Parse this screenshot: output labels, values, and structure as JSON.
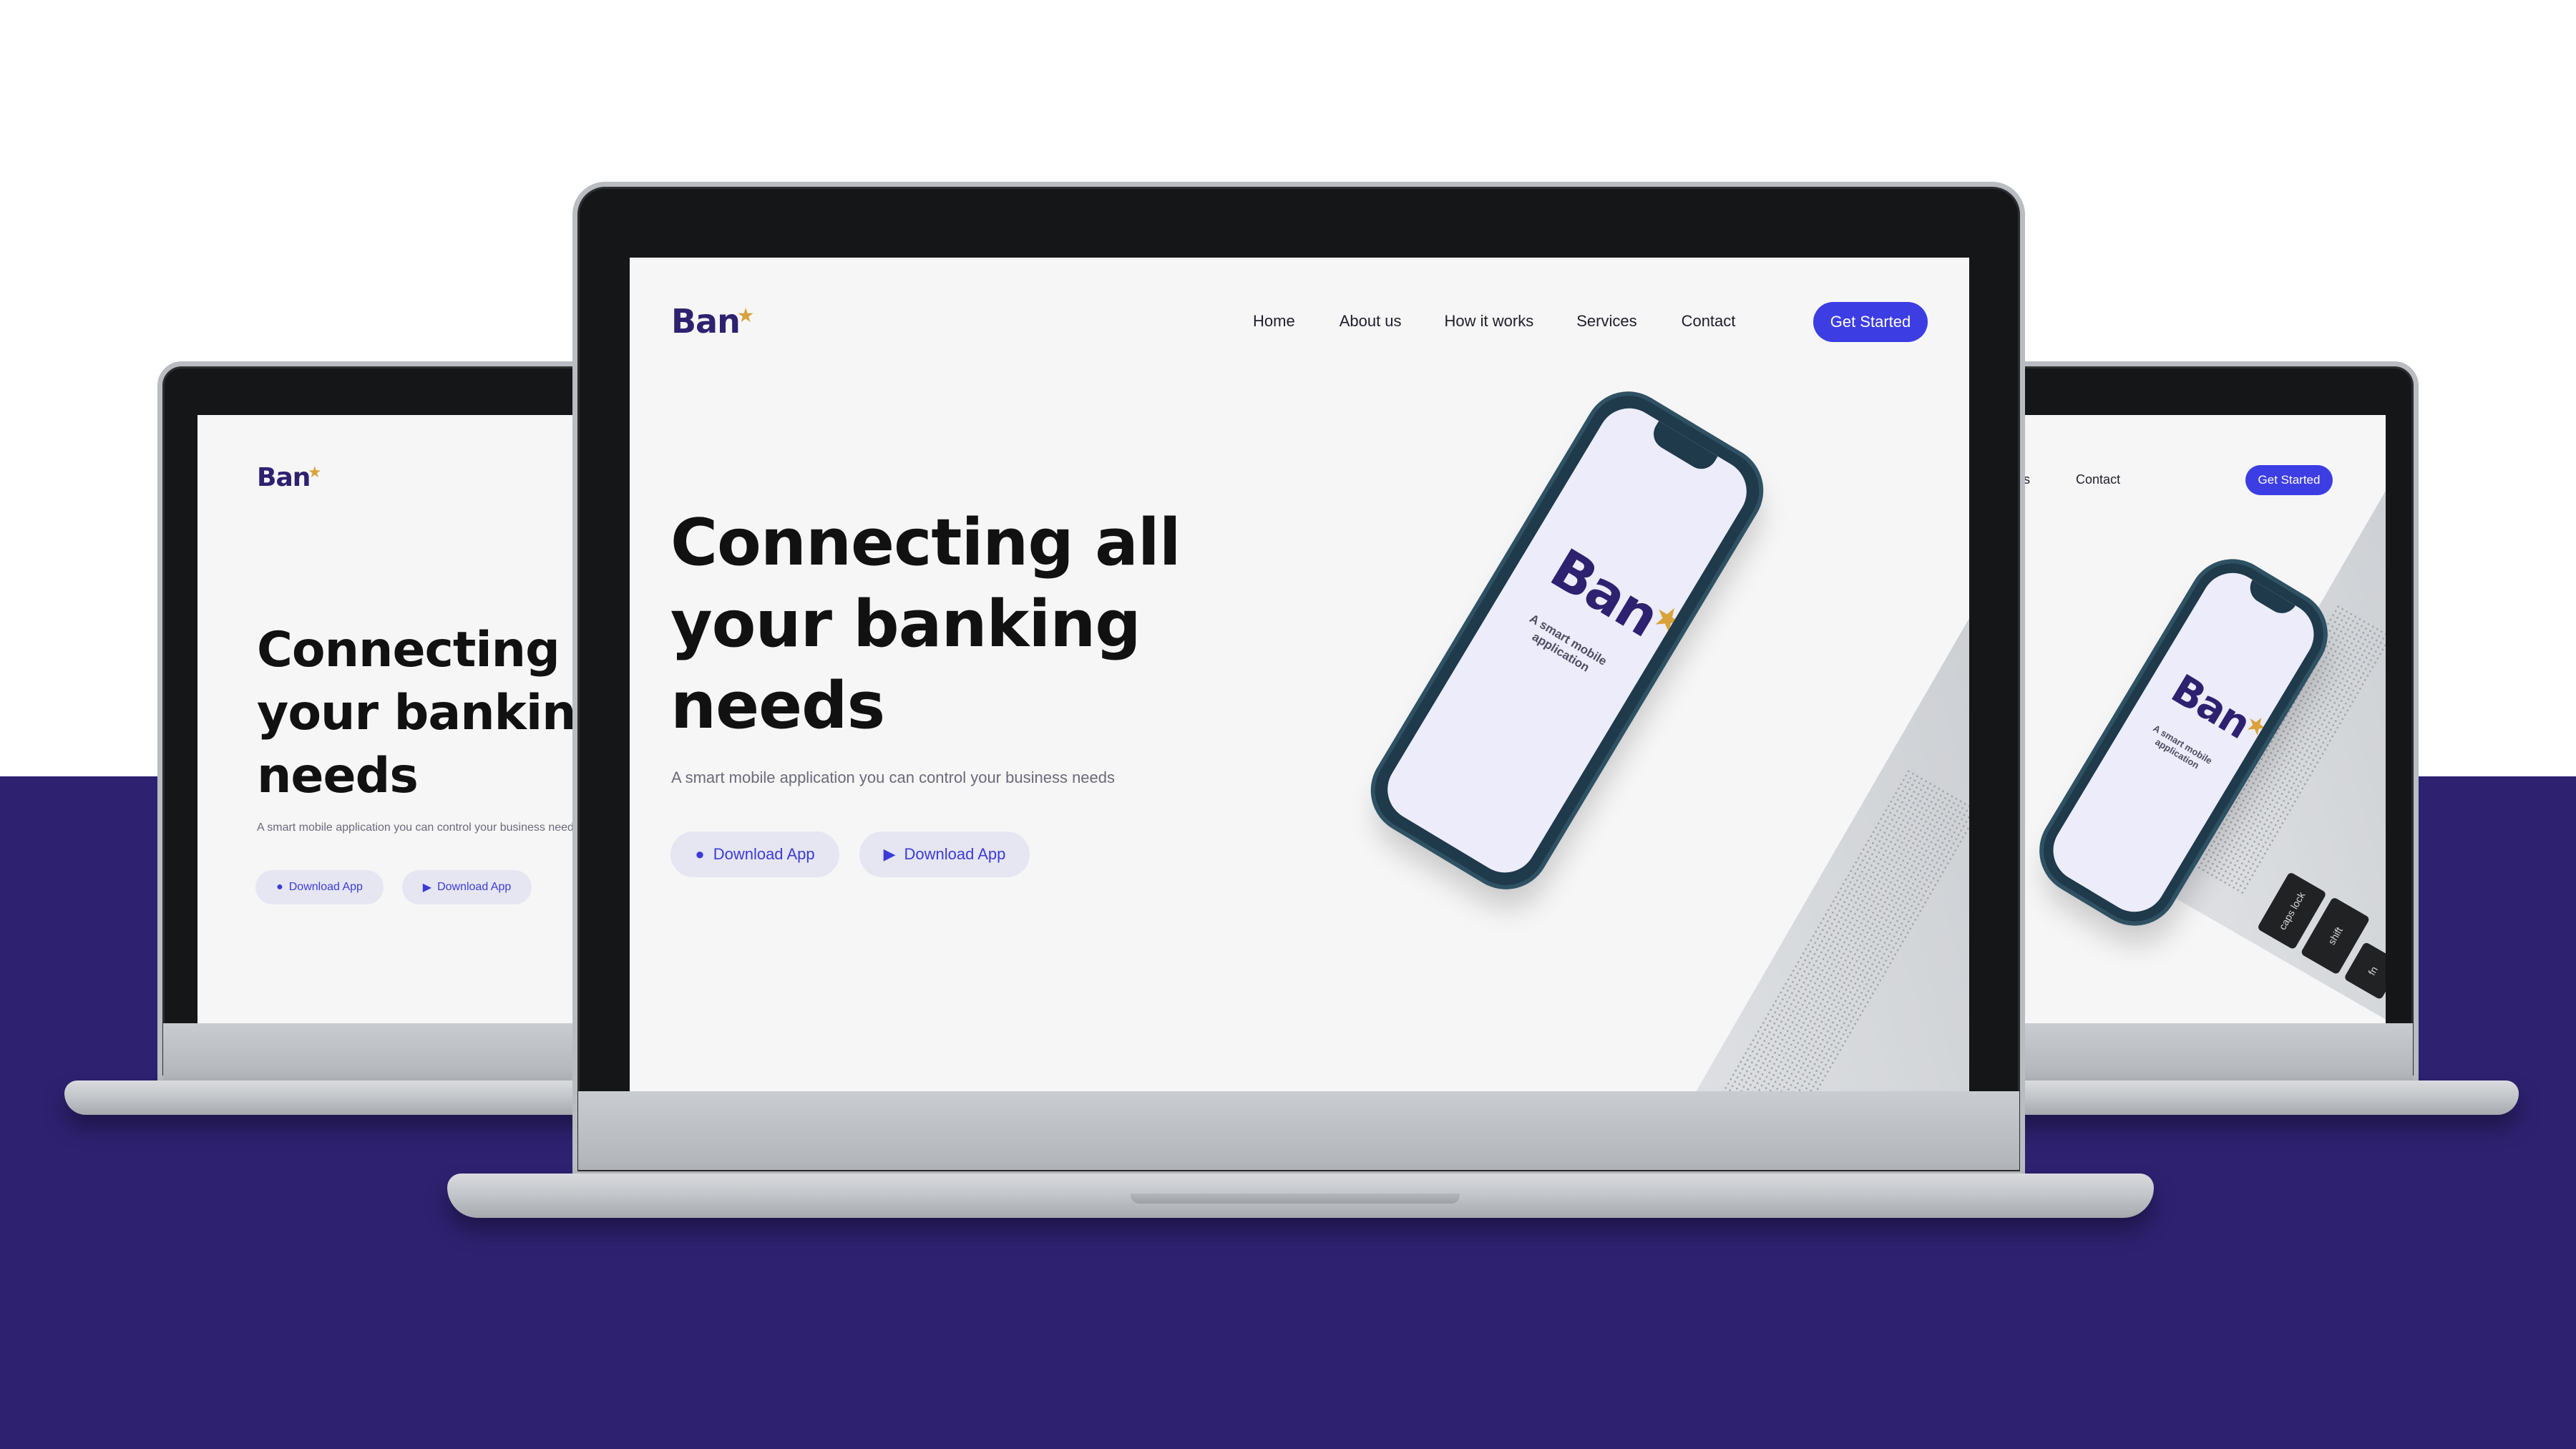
{
  "brand": {
    "name": "Ban",
    "star": "★"
  },
  "nav": [
    "Home",
    "About us",
    "How it works",
    "Services",
    "Contact"
  ],
  "cta": "Get Started",
  "hero": {
    "title_lines": [
      "Connecting all",
      "your banking",
      "needs"
    ],
    "subtitle": "A smart mobile application you can control your business needs"
  },
  "download_buttons": [
    {
      "label": "Download App",
      "icon": "apple-icon"
    },
    {
      "label": "Download App",
      "icon": "play-store-icon"
    }
  ],
  "phone": {
    "logo": "Ban",
    "tagline": "A smart mobile application"
  },
  "keys": [
    "caps lock",
    "shift",
    "fn"
  ],
  "colors": {
    "brand": "#2e2170",
    "accent": "#3d3de4",
    "star": "#d8a33a",
    "background_band": "#2e2170"
  }
}
